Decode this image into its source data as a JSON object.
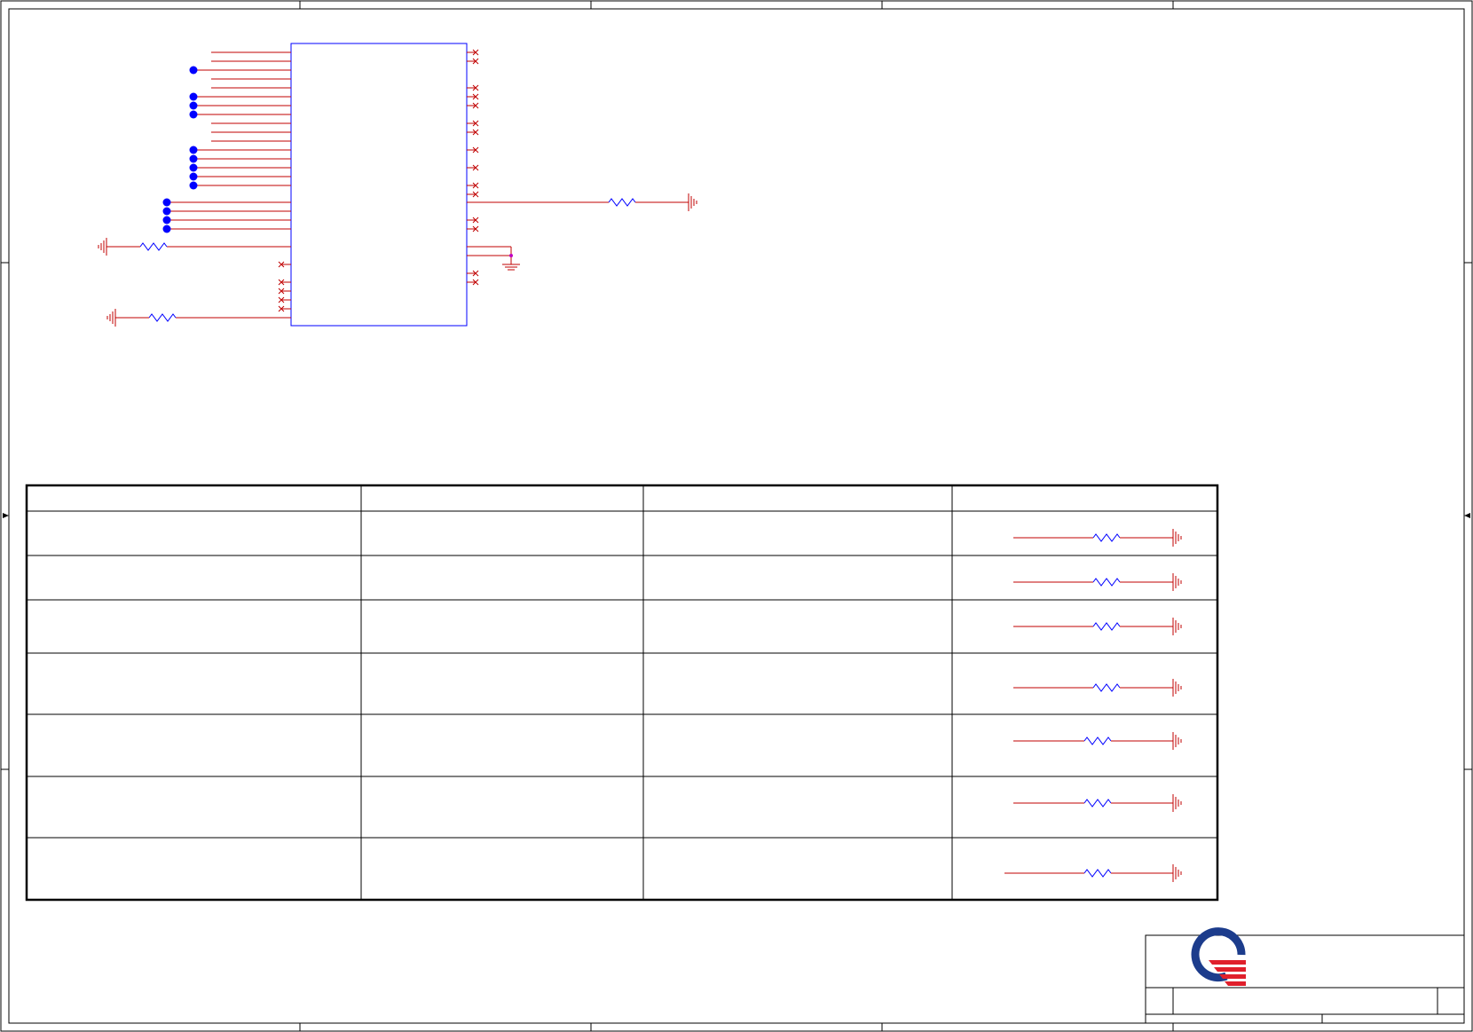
{
  "sheet": {
    "title": "",
    "doc_number": "",
    "revision": "",
    "size": "",
    "date": "",
    "sheet_of": ""
  },
  "chip": {
    "refdes": "",
    "part": "",
    "left_pins": [
      "",
      "",
      "",
      "",
      "",
      "",
      "",
      "",
      "",
      "",
      "",
      "",
      "",
      "",
      "",
      "",
      "",
      "",
      "",
      "",
      "",
      "",
      "",
      "",
      "",
      "",
      "",
      "",
      "",
      "",
      "",
      ""
    ],
    "right_pins": [
      "",
      "",
      "",
      "",
      "",
      "",
      "",
      "",
      "",
      "",
      "",
      "",
      "",
      "",
      "",
      "",
      "",
      "",
      "",
      "",
      "",
      "",
      "",
      "",
      "",
      "",
      "",
      ""
    ]
  },
  "strap_table": {
    "headers": [
      "",
      "",
      "",
      ""
    ],
    "rows": [
      [
        "",
        "",
        ""
      ],
      [
        "",
        "",
        ""
      ],
      [
        "",
        "",
        ""
      ],
      [
        "",
        "",
        ""
      ],
      [
        "",
        "",
        ""
      ],
      [
        "",
        "",
        ""
      ],
      [
        "",
        "",
        ""
      ]
    ]
  },
  "logo": {
    "name": "quanta-logo",
    "colors": {
      "ring": "#1c3c8c",
      "bars": "#e0202c"
    }
  },
  "colors": {
    "wire": "#c00000",
    "component": "#0000ff",
    "border": "#000000",
    "junction": "#0000ff",
    "noconnect": "#c00000",
    "gnd_marker": "#c000c0"
  }
}
